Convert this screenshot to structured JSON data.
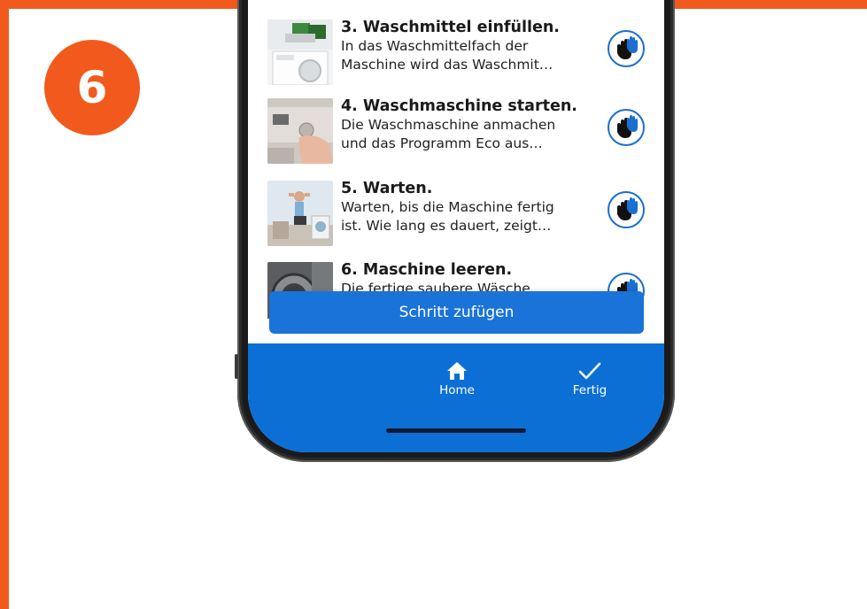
{
  "badge": {
    "number": "6"
  },
  "colors": {
    "accent": "#f25a1d",
    "primary_blue": "#0b6fd6"
  },
  "steps": [
    {
      "title": "3. Waschmittel einfüllen.",
      "description": "In das Waschmittelfach der\nMaschine wird das Waschmit…",
      "icon": "hand-icon"
    },
    {
      "title": "4. Waschmaschine starten.",
      "description": "Die Waschmaschine anmachen\nund das Programm Eco aus…",
      "icon": "hand-icon"
    },
    {
      "title": "5. Warten.",
      "description": "Warten, bis die Maschine fertig\nist. Wie lang es dauert, zeigt…",
      "icon": "hand-icon"
    },
    {
      "title": "6. Maschine leeren.",
      "description": "Die fertige saubere Wäsche",
      "icon": "hand-icon"
    }
  ],
  "add_step_label": "Schritt zufügen",
  "tabbar": {
    "home_label": "Home",
    "done_label": "Fertig"
  }
}
